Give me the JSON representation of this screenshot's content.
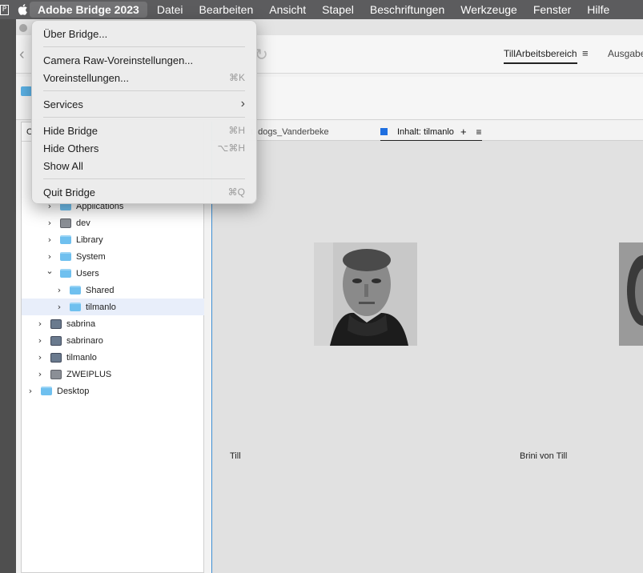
{
  "menubar": {
    "p_icon": "P",
    "app_name": "Adobe Bridge 2023",
    "items": [
      "Datei",
      "Bearbeiten",
      "Ansicht",
      "Stapel",
      "Beschriftungen",
      "Werkzeuge",
      "Fenster",
      "Hilfe"
    ]
  },
  "toolbar": {
    "workspace_active": "TillArbeitsbereich",
    "workspace_next": "Ausgabe",
    "menu_glyph": "≡"
  },
  "left_panel": {
    "tab_label": "O",
    "tree": [
      {
        "label": "Applications",
        "icon": "folder-icon",
        "level": 2,
        "chevron": "right"
      },
      {
        "label": "dev",
        "icon": "disk-icon",
        "level": 2,
        "chevron": "right"
      },
      {
        "label": "Library",
        "icon": "folder-icon",
        "level": 2,
        "chevron": "right"
      },
      {
        "label": "System",
        "icon": "folder-icon",
        "level": 2,
        "chevron": "right"
      },
      {
        "label": "Users",
        "icon": "folder-icon",
        "level": 2,
        "chevron": "down"
      },
      {
        "label": "Shared",
        "icon": "folder-icon",
        "level": 3,
        "chevron": "right"
      },
      {
        "label": "tilmanlo",
        "icon": "user-folder-icon",
        "level": 3,
        "chevron": "right",
        "selected": true
      },
      {
        "label": "sabrina",
        "icon": "network-drive-icon",
        "level": 1,
        "chevron": "right"
      },
      {
        "label": "sabrinaro",
        "icon": "network-drive-icon",
        "level": 1,
        "chevron": "right"
      },
      {
        "label": "tilmanlo",
        "icon": "network-drive-icon",
        "level": 1,
        "chevron": "right"
      },
      {
        "label": "ZWEIPLUS",
        "icon": "disk-icon",
        "level": 1,
        "chevron": "right"
      },
      {
        "label": "Desktop",
        "icon": "folder-icon",
        "level": 0,
        "chevron": "right"
      }
    ]
  },
  "content": {
    "tab_inactive": "t: dogs_Vanderbeke",
    "tab_active": "Inhalt: tilmanlo",
    "tab_plus": "+",
    "tab_menu": "≡",
    "thumbnails": [
      {
        "label": "Till"
      },
      {
        "label": "Brini von Till"
      }
    ]
  },
  "dropdown": {
    "items": [
      {
        "label": "Über Bridge...",
        "shortcut": ""
      },
      {
        "label": "Camera Raw-Voreinstellungen...",
        "shortcut": ""
      },
      {
        "label": "Voreinstellungen...",
        "shortcut": "⌘K"
      },
      {
        "label": "Services",
        "shortcut": "›"
      },
      {
        "label": "Hide Bridge",
        "shortcut": "⌘H"
      },
      {
        "label": "Hide Others",
        "shortcut": "⌥⌘H"
      },
      {
        "label": "Show All",
        "shortcut": ""
      },
      {
        "label": "Quit Bridge",
        "shortcut": "⌘Q"
      }
    ]
  }
}
